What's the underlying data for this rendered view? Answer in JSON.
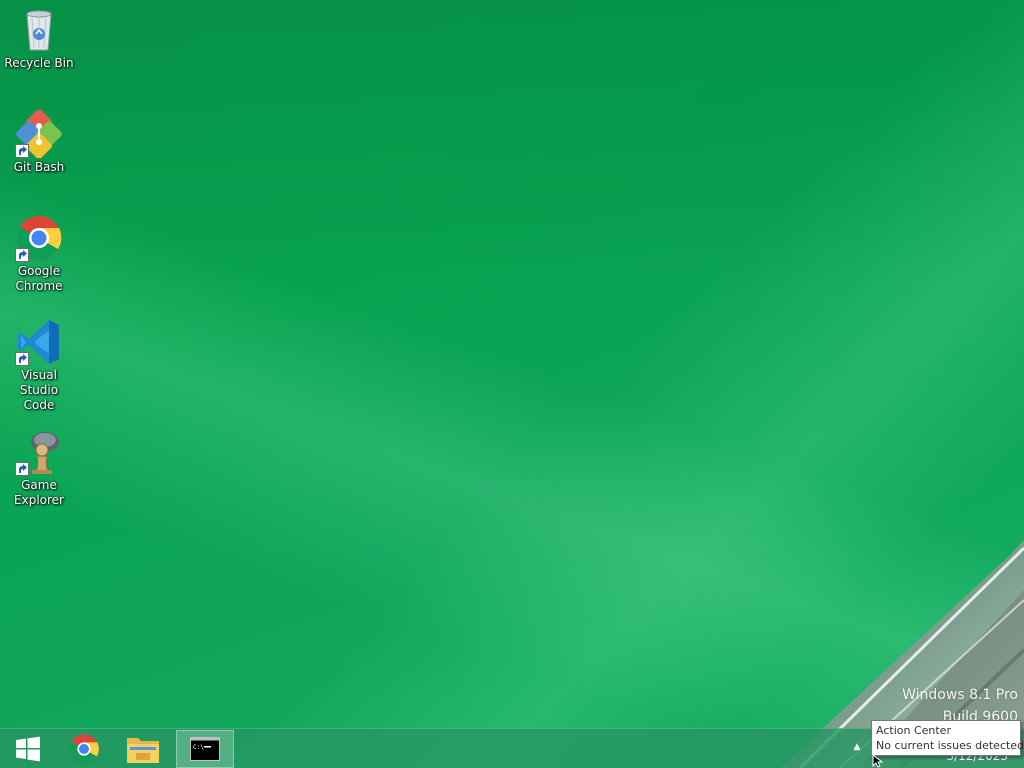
{
  "desktop": {
    "icons": [
      {
        "label": "Recycle Bin",
        "icon": "recycle-bin-icon",
        "shortcut": false
      },
      {
        "label": "Git Bash",
        "icon": "git-bash-icon",
        "shortcut": true
      },
      {
        "label": "Google\nChrome",
        "icon": "chrome-icon",
        "shortcut": true
      },
      {
        "label": "Visual Studio\nCode",
        "icon": "vscode-icon",
        "shortcut": true
      },
      {
        "label": "Game\nExplorer",
        "icon": "game-explorer-icon",
        "shortcut": true
      }
    ],
    "watermark": {
      "line1": "Windows 8.1 Pro",
      "line2": "Build 9600"
    }
  },
  "taskbar": {
    "buttons": [
      {
        "name": "start",
        "icon": "windows-logo-icon"
      },
      {
        "name": "chrome",
        "icon": "chrome-icon"
      },
      {
        "name": "file-explorer",
        "icon": "folder-icon"
      },
      {
        "name": "command-prompt",
        "icon": "cmd-icon",
        "active": true
      }
    ],
    "tray": {
      "show_hidden_icon": "chevron-up-icon",
      "date": "3/12/2023"
    }
  },
  "tooltip": {
    "title": "Action Center",
    "message": "No current issues detected"
  },
  "colors": {
    "wallpaper": "#0aa050",
    "taskbar": "#2a966a"
  }
}
